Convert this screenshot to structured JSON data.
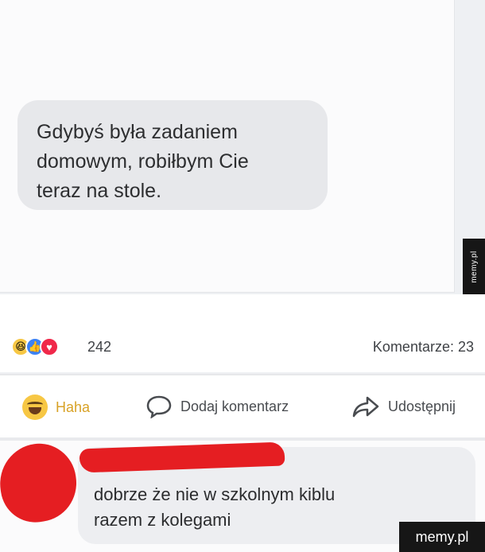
{
  "chat": {
    "message_lines": [
      "Gdybyś była zadaniem",
      "domowym, robiłbym Cie",
      "teraz na stole."
    ]
  },
  "side_watermark": "memy.pl",
  "reactions": {
    "icons": [
      "haha-icon",
      "like-icon",
      "love-icon"
    ],
    "count": "242",
    "comments": "Komentarze: 23"
  },
  "actions": {
    "haha_label": "Haha",
    "comment_label": "Dodaj komentarz",
    "share_label": "Udostępnij"
  },
  "comment": {
    "lines": [
      "dobrze że nie w szkolnym kiblu",
      "razem z kolegami"
    ]
  },
  "bottom_watermark": "memy.pl",
  "colors": {
    "redaction": "#e51e22",
    "haha_accent": "#d8a227",
    "like": "#3b82f6",
    "love": "#f0284a"
  }
}
